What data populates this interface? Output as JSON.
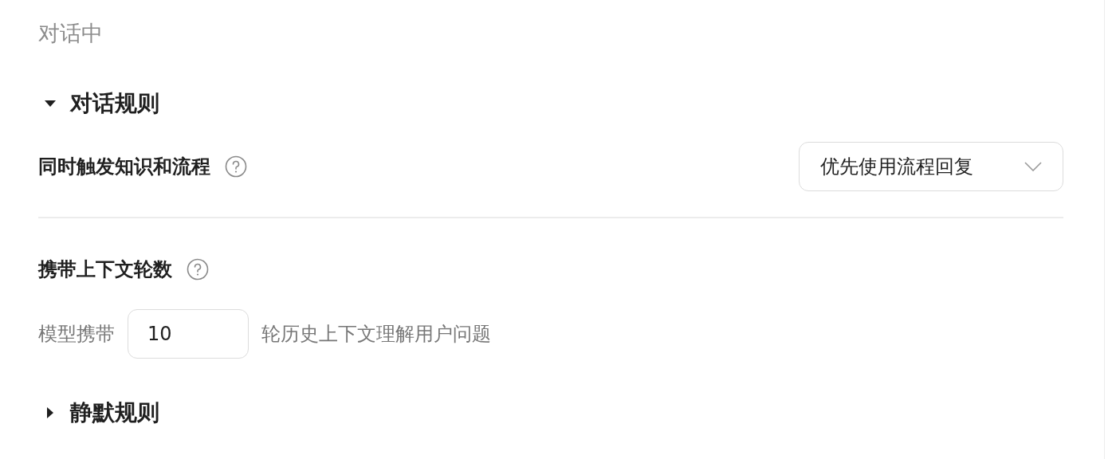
{
  "header": {
    "title": "对话中"
  },
  "sections": [
    {
      "title": "对话规则",
      "expanded": true,
      "settings": [
        {
          "kind": "select",
          "label": "同时触发知识和流程",
          "help": true,
          "value": "优先使用流程回复"
        },
        {
          "kind": "number",
          "label": "携带上下文轮数",
          "help": true,
          "prefix": "模型携带",
          "value": "10",
          "suffix": "轮历史上下文理解用户问题"
        }
      ]
    },
    {
      "title": "静默规则",
      "expanded": false
    }
  ]
}
